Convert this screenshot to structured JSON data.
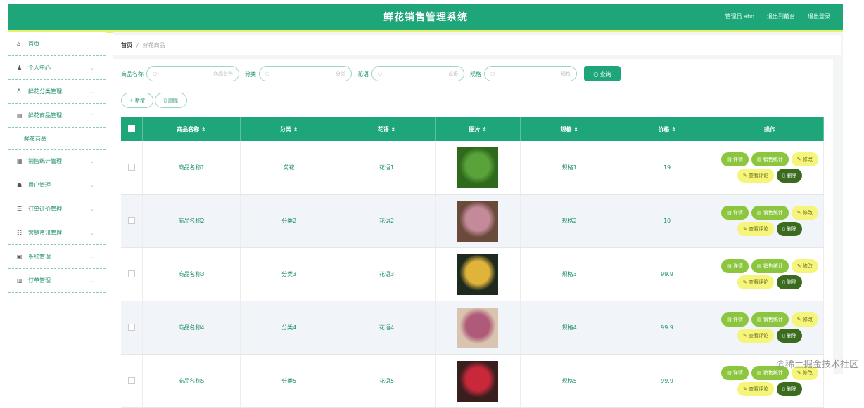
{
  "header": {
    "title": "鲜花销售管理系统",
    "links": [
      "管理员 abo",
      "退出到前台",
      "退出登录"
    ]
  },
  "sidebar": {
    "items": [
      {
        "label": "首页",
        "icon": "home-icon",
        "has_children": false
      },
      {
        "label": "个人中心",
        "icon": "user-icon",
        "has_children": true
      },
      {
        "label": "鲜花分类管理",
        "icon": "flower-icon",
        "has_children": true
      },
      {
        "label": "鲜花商品管理",
        "icon": "box-icon",
        "has_children": true,
        "expanded": true,
        "children": [
          "鲜花商品"
        ]
      },
      {
        "label": "销售统计管理",
        "icon": "chart-icon",
        "has_children": true
      },
      {
        "label": "用户管理",
        "icon": "users-icon",
        "has_children": true
      },
      {
        "label": "订单评价管理",
        "icon": "list-icon",
        "has_children": true
      },
      {
        "label": "营销资讯管理",
        "icon": "news-icon",
        "has_children": true
      },
      {
        "label": "系统管理",
        "icon": "gear-icon",
        "has_children": true
      },
      {
        "label": "订单管理",
        "icon": "order-icon",
        "has_children": true
      }
    ]
  },
  "breadcrumb": {
    "home": "首页",
    "separator": "/",
    "current": "鲜花商品"
  },
  "search": {
    "fields": [
      {
        "label": "商品名称",
        "placeholder": "商品名称"
      },
      {
        "label": "分类",
        "placeholder": "分类"
      },
      {
        "label": "花语",
        "placeholder": "花语"
      },
      {
        "label": "规格",
        "placeholder": "规格"
      }
    ],
    "button": "查询"
  },
  "actions": {
    "add": "+ 新增",
    "delete": "删除"
  },
  "table": {
    "columns": [
      "商品名称 ⇕",
      "分类 ⇕",
      "花语 ⇕",
      "图片 ⇕",
      "规格 ⇕",
      "价格 ⇕",
      "操作"
    ],
    "rows": [
      {
        "name": "商品名称1",
        "category": "菊花",
        "language": "花语1",
        "spec": "规格1",
        "price": "19",
        "image_colors": [
          "#2f6a1c",
          "#5aa33a"
        ]
      },
      {
        "name": "商品名称2",
        "category": "分类2",
        "language": "花语2",
        "spec": "规格2",
        "price": "10",
        "image_colors": [
          "#6a4a3a",
          "#c48a9a"
        ]
      },
      {
        "name": "商品名称3",
        "category": "分类3",
        "language": "花语3",
        "spec": "规格3",
        "price": "99.9",
        "image_colors": [
          "#1e2a1e",
          "#e0b43a"
        ]
      },
      {
        "name": "商品名称4",
        "category": "分类4",
        "language": "花语4",
        "spec": "规格4",
        "price": "99.9",
        "image_colors": [
          "#d9c4b0",
          "#b05a7a"
        ]
      },
      {
        "name": "商品名称5",
        "category": "分类5",
        "language": "花语5",
        "spec": "规格5",
        "price": "99.9",
        "image_colors": [
          "#3a1e1e",
          "#c8283a"
        ]
      }
    ],
    "row_ops": {
      "detail": "详情",
      "sales": "销售统计",
      "edit": "修改",
      "review": "查看评论",
      "delete": "删除"
    }
  },
  "watermark": "@稀土掘金技术社区",
  "colors": {
    "primary": "#1fa57a",
    "accent_bar": "#e9f36a",
    "op_green": "#8cc63f",
    "op_yellow": "#f4f57a",
    "op_dark": "#3a6b1f"
  }
}
